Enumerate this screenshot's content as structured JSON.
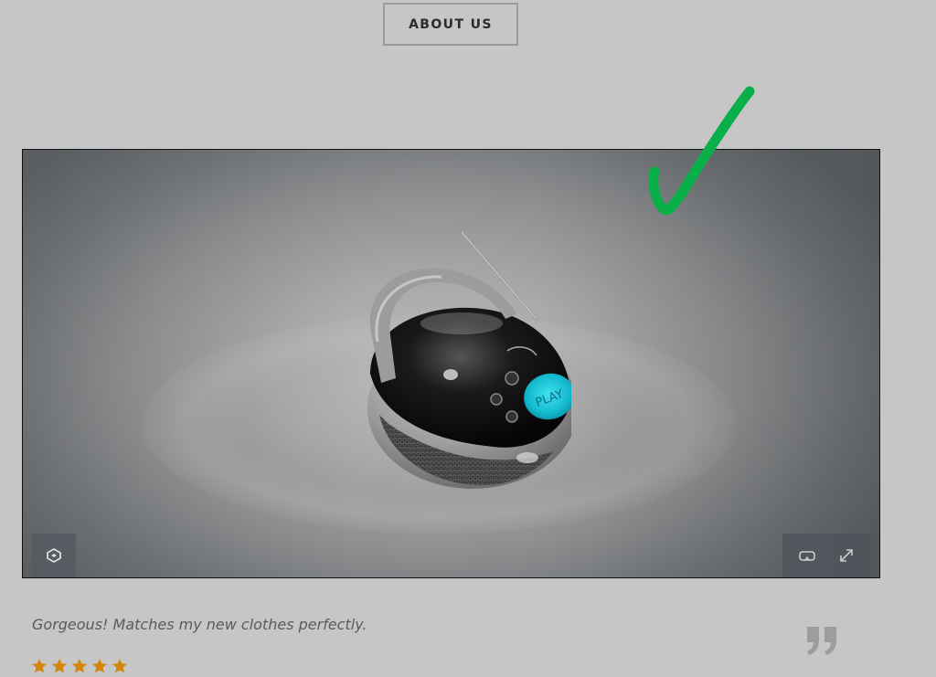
{
  "header": {
    "about_label": "ABOUT US"
  },
  "viewer": {
    "model_button_label": "PLAY",
    "controls": {
      "left": [
        "ar-cube-icon"
      ],
      "right": [
        "vr-headset-icon",
        "fullscreen-icon"
      ]
    }
  },
  "annotation": {
    "checkmark_color": "#09b04a"
  },
  "review": {
    "text": "Gorgeous! Matches my new clothes perfectly.",
    "rating": 5,
    "rating_max": 5,
    "star_color": "#d4860b",
    "quote_icon": "closing-quote-icon"
  },
  "colors": {
    "background": "#c6c6c6",
    "control_bg": "#5b5f66",
    "play_accent": "#1fc3d6"
  }
}
